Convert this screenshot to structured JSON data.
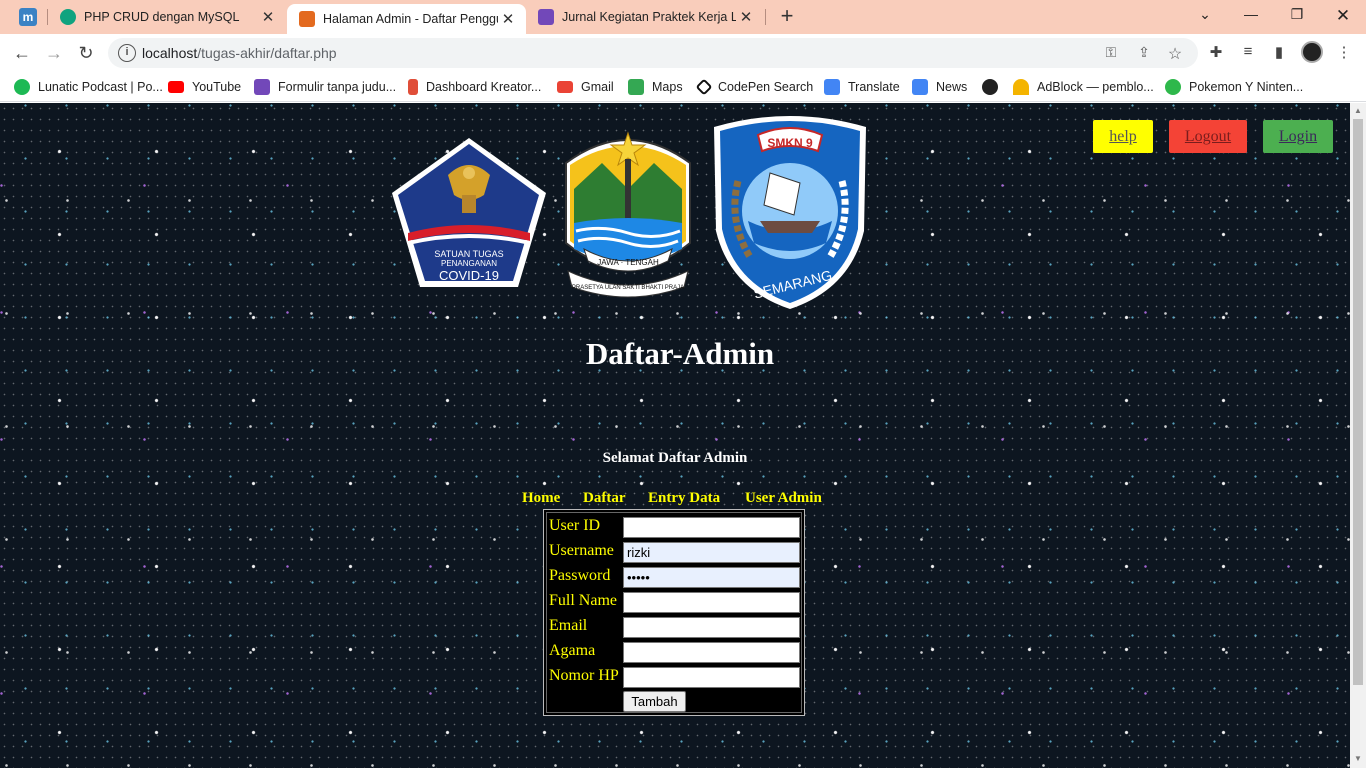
{
  "browser": {
    "tabs": [
      {
        "title": "PHP CRUD dengan MySQL",
        "favicon": "chatgpt-icon",
        "color": "#10a37f"
      },
      {
        "title": "Halaman Admin - Daftar Penggu",
        "favicon": "xampp-icon",
        "color": "#e36a1f"
      },
      {
        "title": "Jurnal Kegiatan Praktek Kerja Lap",
        "favicon": "forms-icon",
        "color": "#7248b9"
      }
    ],
    "pinned_tab_letter": "m",
    "new_tab_symbol": "+",
    "url_host": "localhost",
    "url_path": "/tugas-akhir/daftar.php",
    "bookmarks": [
      {
        "label": "Lunatic Podcast | Po...",
        "icon": "spotify-icon",
        "color": "#1db954"
      },
      {
        "label": "YouTube",
        "icon": "youtube-icon",
        "color": "#ff0000"
      },
      {
        "label": "Formulir tanpa judu...",
        "icon": "forms-icon",
        "color": "#7248b9"
      },
      {
        "label": "Dashboard Kreator...",
        "icon": "kreator-icon",
        "color": "#e04e39"
      },
      {
        "label": "Gmail",
        "icon": "gmail-icon",
        "color": "#ea4335"
      },
      {
        "label": "Maps",
        "icon": "maps-icon",
        "color": "#34a853"
      },
      {
        "label": "CodePen Search",
        "icon": "codepen-icon",
        "color": "#111111"
      },
      {
        "label": "Translate",
        "icon": "translate-icon",
        "color": "#4285f4"
      },
      {
        "label": "News",
        "icon": "news-icon",
        "color": "#4285f4"
      },
      {
        "label": "",
        "icon": "globe-icon",
        "color": "#222222"
      },
      {
        "label": "AdBlock — pemblo...",
        "icon": "adblock-icon",
        "color": "#f4b400"
      },
      {
        "label": "Pokemon Y Ninten...",
        "icon": "pokemon-icon",
        "color": "#2eb84b"
      }
    ]
  },
  "page": {
    "buttons": {
      "help": {
        "label": "help",
        "bg": "#ffff00",
        "fg": "#555555"
      },
      "logout": {
        "label": "Logout",
        "bg": "#f44336",
        "fg": "#7a1d1d"
      },
      "login": {
        "label": "Login",
        "bg": "#4caf50",
        "fg": "#3b2a5a"
      }
    },
    "logos": {
      "covid": {
        "line1": "SATUAN TUGAS",
        "line2": "PENANGANAN",
        "line3": "COVID-19"
      },
      "jateng": {
        "band": "JAWA · TENGAH",
        "motto": "PRASETYA ULAN SAKTI BHAKTI PRAJA"
      },
      "smkn": {
        "top": "SMKN 9",
        "bottom": "SEMARANG"
      }
    },
    "title": "Daftar-Admin",
    "welcome": "Selamat Daftar Admin",
    "menu": [
      "Home",
      "Daftar",
      "Entry Data",
      "User Admin"
    ],
    "form": {
      "fields": [
        {
          "label": "User ID",
          "value": ""
        },
        {
          "label": "Username",
          "value": "rizki"
        },
        {
          "label": "Password",
          "value": "•••••"
        },
        {
          "label": "Full Name",
          "value": ""
        },
        {
          "label": "Email",
          "value": ""
        },
        {
          "label": "Agama",
          "value": ""
        },
        {
          "label": "Nomor HP",
          "value": ""
        }
      ],
      "submit_label": "Tambah"
    },
    "colors": {
      "menu": "#ffff00",
      "form_label": "#ffff00",
      "title": "#ffffff"
    }
  }
}
